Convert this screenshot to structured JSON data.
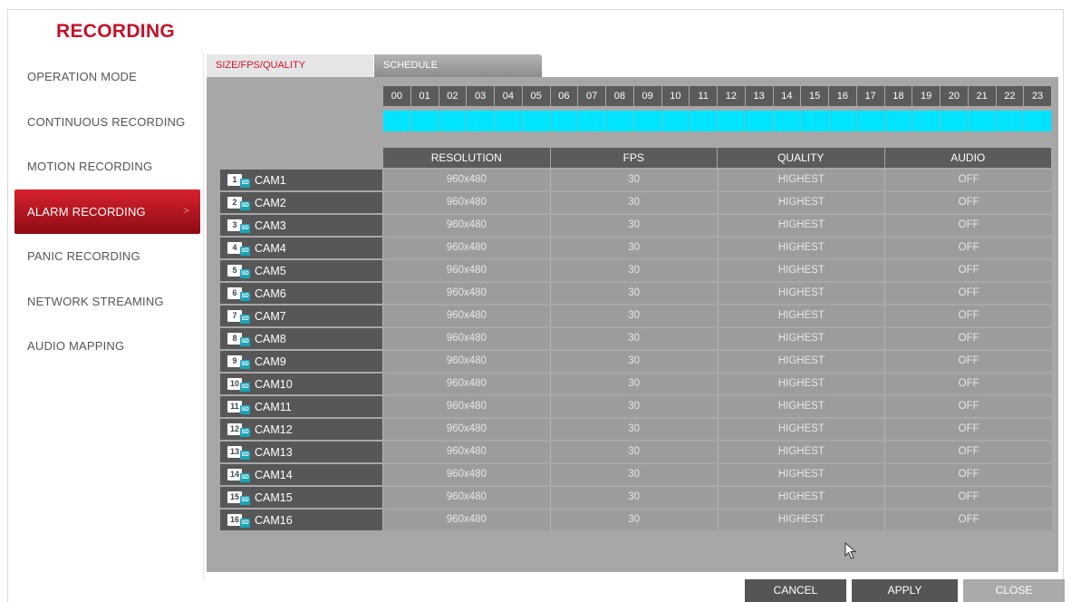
{
  "title": "RECORDING",
  "menu": {
    "items": [
      {
        "label": "OPERATION MODE",
        "active": false
      },
      {
        "label": "CONTINUOUS RECORDING",
        "active": false
      },
      {
        "label": "MOTION RECORDING",
        "active": false
      },
      {
        "label": "ALARM RECORDING",
        "active": true
      },
      {
        "label": "PANIC RECORDING",
        "active": false
      },
      {
        "label": "NETWORK STREAMING",
        "active": false
      },
      {
        "label": "AUDIO MAPPING",
        "active": false
      }
    ],
    "active_arrow": ">"
  },
  "tabs": [
    {
      "label": "SIZE/FPS/QUALITY",
      "active": true
    },
    {
      "label": "SCHEDULE",
      "active": false
    }
  ],
  "hours": [
    "00",
    "01",
    "02",
    "03",
    "04",
    "05",
    "06",
    "07",
    "08",
    "09",
    "10",
    "11",
    "12",
    "13",
    "14",
    "15",
    "16",
    "17",
    "18",
    "19",
    "20",
    "21",
    "22",
    "23"
  ],
  "table": {
    "headers": [
      "RESOLUTION",
      "FPS",
      "QUALITY",
      "AUDIO"
    ],
    "rows": [
      {
        "num": "1",
        "cam": "CAM1",
        "resolution": "960x480",
        "fps": "30",
        "quality": "HIGHEST",
        "audio": "OFF"
      },
      {
        "num": "2",
        "cam": "CAM2",
        "resolution": "960x480",
        "fps": "30",
        "quality": "HIGHEST",
        "audio": "OFF"
      },
      {
        "num": "3",
        "cam": "CAM3",
        "resolution": "960x480",
        "fps": "30",
        "quality": "HIGHEST",
        "audio": "OFF"
      },
      {
        "num": "4",
        "cam": "CAM4",
        "resolution": "960x480",
        "fps": "30",
        "quality": "HIGHEST",
        "audio": "OFF"
      },
      {
        "num": "5",
        "cam": "CAM5",
        "resolution": "960x480",
        "fps": "30",
        "quality": "HIGHEST",
        "audio": "OFF"
      },
      {
        "num": "6",
        "cam": "CAM6",
        "resolution": "960x480",
        "fps": "30",
        "quality": "HIGHEST",
        "audio": "OFF"
      },
      {
        "num": "7",
        "cam": "CAM7",
        "resolution": "960x480",
        "fps": "30",
        "quality": "HIGHEST",
        "audio": "OFF"
      },
      {
        "num": "8",
        "cam": "CAM8",
        "resolution": "960x480",
        "fps": "30",
        "quality": "HIGHEST",
        "audio": "OFF"
      },
      {
        "num": "9",
        "cam": "CAM9",
        "resolution": "960x480",
        "fps": "30",
        "quality": "HIGHEST",
        "audio": "OFF"
      },
      {
        "num": "10",
        "cam": "CAM10",
        "resolution": "960x480",
        "fps": "30",
        "quality": "HIGHEST",
        "audio": "OFF"
      },
      {
        "num": "11",
        "cam": "CAM11",
        "resolution": "960x480",
        "fps": "30",
        "quality": "HIGHEST",
        "audio": "OFF"
      },
      {
        "num": "12",
        "cam": "CAM12",
        "resolution": "960x480",
        "fps": "30",
        "quality": "HIGHEST",
        "audio": "OFF"
      },
      {
        "num": "13",
        "cam": "CAM13",
        "resolution": "960x480",
        "fps": "30",
        "quality": "HIGHEST",
        "audio": "OFF"
      },
      {
        "num": "14",
        "cam": "CAM14",
        "resolution": "960x480",
        "fps": "30",
        "quality": "HIGHEST",
        "audio": "OFF"
      },
      {
        "num": "15",
        "cam": "CAM15",
        "resolution": "960x480",
        "fps": "30",
        "quality": "HIGHEST",
        "audio": "OFF"
      },
      {
        "num": "16",
        "cam": "CAM16",
        "resolution": "960x480",
        "fps": "30",
        "quality": "HIGHEST",
        "audio": "OFF"
      }
    ]
  },
  "sd_badge": "SD",
  "buttons": {
    "cancel": "CANCEL",
    "apply": "APPLY",
    "close": "CLOSE"
  },
  "colors": {
    "accent": "#c1122b",
    "schedule_active": "#00e4ff",
    "panel": "#a7a7a7"
  }
}
